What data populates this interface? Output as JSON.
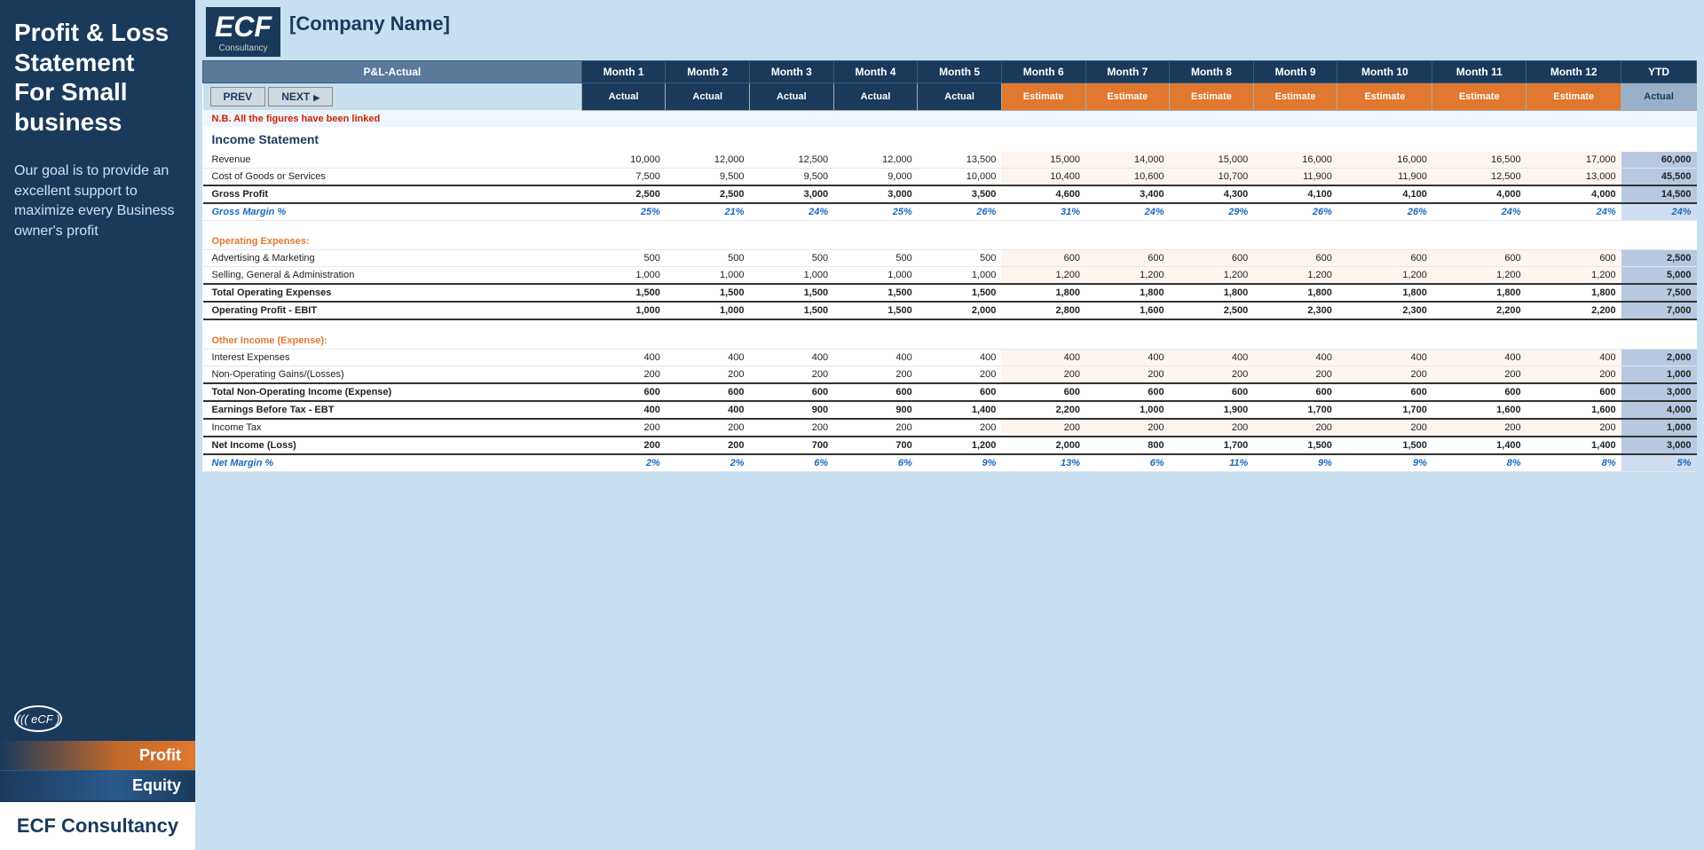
{
  "sidebar": {
    "title": "Profit & Loss Statement For Small business",
    "description": "Our goal is to provide an excellent support to maximize every Business owner's profit",
    "logo_text": "((( eCF )",
    "nav_items": [
      {
        "label": "Profit",
        "type": "profit"
      },
      {
        "label": "Equity",
        "type": "equity"
      }
    ],
    "bottom_text": "ECF Consultancy"
  },
  "header": {
    "ecf_text": "ECF",
    "ecf_sub": "Consultancy",
    "company_name": "[Company Name]"
  },
  "table": {
    "pl_actual_label": "P&L-Actual",
    "prev_label": "PREV",
    "next_label": "NEXT",
    "note": "N.B. All the figures have been linked",
    "months": [
      "Month 1",
      "Month 2",
      "Month 3",
      "Month 4",
      "Month 5",
      "Month 6",
      "Month 7",
      "Month 8",
      "Month 9",
      "Month 10",
      "Month 11",
      "Month 12",
      "YTD"
    ],
    "types": [
      "Actual",
      "Actual",
      "Actual",
      "Actual",
      "Actual",
      "Estimate",
      "Estimate",
      "Estimate",
      "Estimate",
      "Estimate",
      "Estimate",
      "Estimate",
      "Actual"
    ],
    "income_statement_label": "Income Statement",
    "sections": [
      {
        "type": "data",
        "label": "Revenue",
        "values": [
          "10,000",
          "12,000",
          "12,500",
          "12,000",
          "13,500",
          "15,000",
          "14,000",
          "15,000",
          "16,000",
          "16,000",
          "16,500",
          "17,000",
          "60,000"
        ]
      },
      {
        "type": "data",
        "label": "Cost of Goods or Services",
        "values": [
          "7,500",
          "9,500",
          "9,500",
          "9,000",
          "10,000",
          "10,400",
          "10,600",
          "10,700",
          "11,900",
          "11,900",
          "12,500",
          "13,000",
          "45,500"
        ]
      },
      {
        "type": "bold",
        "label": "Gross Profit",
        "values": [
          "2,500",
          "2,500",
          "3,000",
          "3,000",
          "3,500",
          "4,600",
          "3,400",
          "4,300",
          "4,100",
          "4,100",
          "4,000",
          "4,000",
          "14,500"
        ]
      },
      {
        "type": "italic-blue",
        "label": "Gross Margin %",
        "values": [
          "25%",
          "21%",
          "24%",
          "25%",
          "26%",
          "31%",
          "24%",
          "29%",
          "26%",
          "26%",
          "24%",
          "24%",
          "24%"
        ]
      },
      {
        "type": "spacer"
      },
      {
        "type": "section-header",
        "label": "Operating Expenses:"
      },
      {
        "type": "data",
        "label": "Advertising & Marketing",
        "values": [
          "500",
          "500",
          "500",
          "500",
          "500",
          "600",
          "600",
          "600",
          "600",
          "600",
          "600",
          "600",
          "2,500"
        ]
      },
      {
        "type": "data",
        "label": "Selling, General & Administration",
        "values": [
          "1,000",
          "1,000",
          "1,000",
          "1,000",
          "1,000",
          "1,200",
          "1,200",
          "1,200",
          "1,200",
          "1,200",
          "1,200",
          "1,200",
          "5,000"
        ]
      },
      {
        "type": "bold",
        "label": "Total Operating Expenses",
        "values": [
          "1,500",
          "1,500",
          "1,500",
          "1,500",
          "1,500",
          "1,800",
          "1,800",
          "1,800",
          "1,800",
          "1,800",
          "1,800",
          "1,800",
          "7,500"
        ]
      },
      {
        "type": "bold",
        "label": "Operating Profit - EBIT",
        "values": [
          "1,000",
          "1,000",
          "1,500",
          "1,500",
          "2,000",
          "2,800",
          "1,600",
          "2,500",
          "2,300",
          "2,300",
          "2,200",
          "2,200",
          "7,000"
        ]
      },
      {
        "type": "spacer"
      },
      {
        "type": "section-header",
        "label": "Other Income (Expense):"
      },
      {
        "type": "data",
        "label": "Interest Expenses",
        "values": [
          "400",
          "400",
          "400",
          "400",
          "400",
          "400",
          "400",
          "400",
          "400",
          "400",
          "400",
          "400",
          "2,000"
        ]
      },
      {
        "type": "data",
        "label": "Non-Operating Gains/(Losses)",
        "values": [
          "200",
          "200",
          "200",
          "200",
          "200",
          "200",
          "200",
          "200",
          "200",
          "200",
          "200",
          "200",
          "1,000"
        ]
      },
      {
        "type": "bold",
        "label": "Total Non-Operating Income (Expense)",
        "values": [
          "600",
          "600",
          "600",
          "600",
          "600",
          "600",
          "600",
          "600",
          "600",
          "600",
          "600",
          "600",
          "3,000"
        ]
      },
      {
        "type": "bold",
        "label": "Earnings Before Tax - EBT",
        "values": [
          "400",
          "400",
          "900",
          "900",
          "1,400",
          "2,200",
          "1,000",
          "1,900",
          "1,700",
          "1,700",
          "1,600",
          "1,600",
          "4,000"
        ]
      },
      {
        "type": "data",
        "label": "Income Tax",
        "values": [
          "200",
          "200",
          "200",
          "200",
          "200",
          "200",
          "200",
          "200",
          "200",
          "200",
          "200",
          "200",
          "1,000"
        ]
      },
      {
        "type": "bold",
        "label": "Net Income (Loss)",
        "values": [
          "200",
          "200",
          "700",
          "700",
          "1,200",
          "2,000",
          "800",
          "1,700",
          "1,500",
          "1,500",
          "1,400",
          "1,400",
          "3,000"
        ]
      },
      {
        "type": "italic-blue",
        "label": "Net Margin %",
        "values": [
          "2%",
          "2%",
          "6%",
          "6%",
          "9%",
          "13%",
          "6%",
          "11%",
          "9%",
          "9%",
          "8%",
          "8%",
          "5%"
        ]
      }
    ]
  }
}
